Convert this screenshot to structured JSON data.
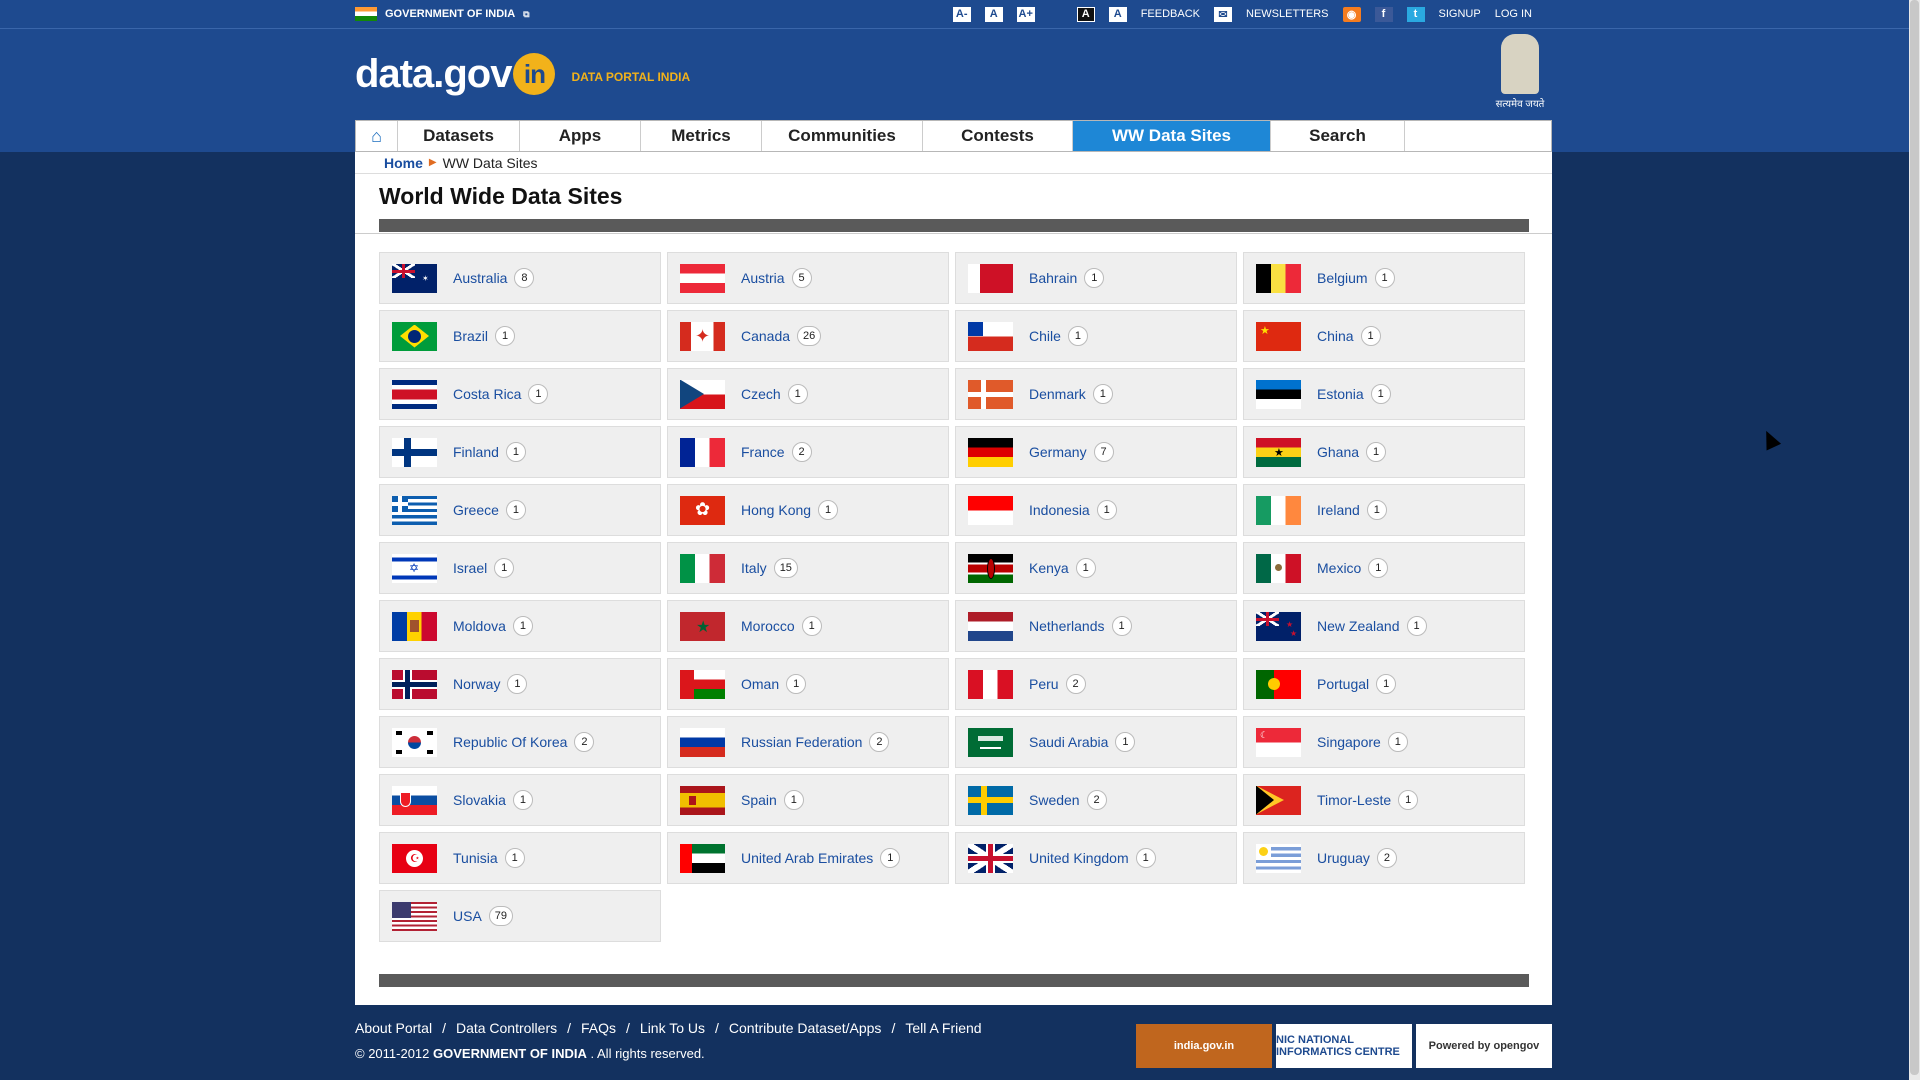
{
  "util": {
    "gov": "GOVERNMENT OF INDIA",
    "ext": "⧉",
    "a_minus": "A-",
    "a_normal": "A",
    "a_plus": "A+",
    "a_dark": "A",
    "a_light": "A",
    "feedback": "FEEDBACK",
    "newsletters": "NEWSLETTERS",
    "signup": "SIGNUP",
    "login": "LOG IN"
  },
  "brand": {
    "logo_main": "data.gov",
    "logo_in": "in",
    "tagline": "DATA PORTAL INDIA",
    "emblem_motto": "सत्यमेव जयते"
  },
  "nav": [
    {
      "label": "Datasets",
      "width": 122
    },
    {
      "label": "Apps",
      "width": 121
    },
    {
      "label": "Metrics",
      "width": 121
    },
    {
      "label": "Communities",
      "width": 161
    },
    {
      "label": "Contests",
      "width": 150
    },
    {
      "label": "WW Data Sites",
      "width": 198,
      "active": true
    },
    {
      "label": "Search",
      "width": 134
    }
  ],
  "breadcrumb": {
    "home": "Home",
    "current": "WW Data Sites"
  },
  "page_title": "World Wide Data Sites",
  "countries": [
    {
      "name": "Australia",
      "count": "8",
      "flag": "australia"
    },
    {
      "name": "Austria",
      "count": "5",
      "flag": "austria"
    },
    {
      "name": "Bahrain",
      "count": "1",
      "flag": "bahrain"
    },
    {
      "name": "Belgium",
      "count": "1",
      "flag": "belgium"
    },
    {
      "name": "Brazil",
      "count": "1",
      "flag": "brazil"
    },
    {
      "name": "Canada",
      "count": "26",
      "flag": "canada"
    },
    {
      "name": "Chile",
      "count": "1",
      "flag": "chile"
    },
    {
      "name": "China",
      "count": "1",
      "flag": "china"
    },
    {
      "name": "Costa Rica",
      "count": "1",
      "flag": "costarica"
    },
    {
      "name": "Czech",
      "count": "1",
      "flag": "czech"
    },
    {
      "name": "Denmark",
      "count": "1",
      "flag": "denmark"
    },
    {
      "name": "Estonia",
      "count": "1",
      "flag": "estonia"
    },
    {
      "name": "Finland",
      "count": "1",
      "flag": "finland"
    },
    {
      "name": "France",
      "count": "2",
      "flag": "france"
    },
    {
      "name": "Germany",
      "count": "7",
      "flag": "germany"
    },
    {
      "name": "Ghana",
      "count": "1",
      "flag": "ghana"
    },
    {
      "name": "Greece",
      "count": "1",
      "flag": "greece"
    },
    {
      "name": "Hong Kong",
      "count": "1",
      "flag": "hongkong"
    },
    {
      "name": "Indonesia",
      "count": "1",
      "flag": "indonesia"
    },
    {
      "name": "Ireland",
      "count": "1",
      "flag": "ireland"
    },
    {
      "name": "Israel",
      "count": "1",
      "flag": "israel"
    },
    {
      "name": "Italy",
      "count": "15",
      "flag": "italy"
    },
    {
      "name": "Kenya",
      "count": "1",
      "flag": "kenya"
    },
    {
      "name": "Mexico",
      "count": "1",
      "flag": "mexico"
    },
    {
      "name": "Moldova",
      "count": "1",
      "flag": "moldova"
    },
    {
      "name": "Morocco",
      "count": "1",
      "flag": "morocco"
    },
    {
      "name": "Netherlands",
      "count": "1",
      "flag": "netherlands"
    },
    {
      "name": "New Zealand",
      "count": "1",
      "flag": "newzealand"
    },
    {
      "name": "Norway",
      "count": "1",
      "flag": "norway"
    },
    {
      "name": "Oman",
      "count": "1",
      "flag": "oman"
    },
    {
      "name": "Peru",
      "count": "2",
      "flag": "peru"
    },
    {
      "name": "Portugal",
      "count": "1",
      "flag": "portugal"
    },
    {
      "name": "Republic Of Korea",
      "count": "2",
      "flag": "korea"
    },
    {
      "name": "Russian Federation",
      "count": "2",
      "flag": "russia"
    },
    {
      "name": "Saudi Arabia",
      "count": "1",
      "flag": "saudi"
    },
    {
      "name": "Singapore",
      "count": "1",
      "flag": "singapore"
    },
    {
      "name": "Slovakia",
      "count": "1",
      "flag": "slovakia"
    },
    {
      "name": "Spain",
      "count": "1",
      "flag": "spain"
    },
    {
      "name": "Sweden",
      "count": "2",
      "flag": "sweden"
    },
    {
      "name": "Timor-Leste",
      "count": "1",
      "flag": "timor"
    },
    {
      "name": "Tunisia",
      "count": "1",
      "flag": "tunisia"
    },
    {
      "name": "United Arab Emirates",
      "count": "1",
      "flag": "uae"
    },
    {
      "name": "United Kingdom",
      "count": "1",
      "flag": "uk"
    },
    {
      "name": "Uruguay",
      "count": "2",
      "flag": "uruguay"
    },
    {
      "name": "USA",
      "count": "79",
      "flag": "usa"
    }
  ],
  "footer": {
    "links": [
      "About Portal",
      "Data Controllers",
      "FAQs",
      "Link To Us",
      "Contribute Dataset/Apps",
      "Tell A Friend"
    ],
    "copyright_pre": "© 2011-2012",
    "copyright_org": "GOVERNMENT OF INDIA",
    "copyright_post": ". All rights reserved.",
    "badge_india": "india.gov.in",
    "badge_nic": "NIC NATIONAL INFORMATICS CENTRE",
    "badge_opengov": "Powered by opengov"
  },
  "colors": {
    "page_bg": "#13315f",
    "header_bg": "#1e4a8f",
    "accent_active_tab": "#1e87d6",
    "link": "#1a4ea0",
    "tagline": "#f2b21a"
  }
}
